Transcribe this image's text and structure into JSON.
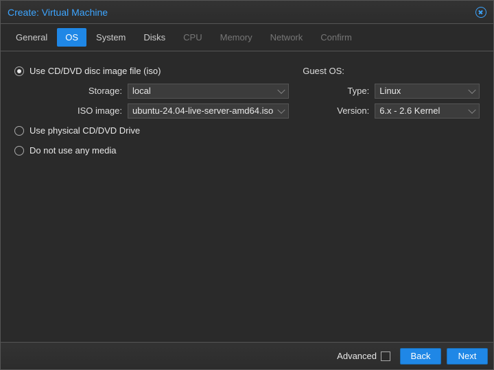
{
  "header": {
    "title": "Create: Virtual Machine"
  },
  "tabs": [
    {
      "label": "General",
      "state": "enabled"
    },
    {
      "label": "OS",
      "state": "active"
    },
    {
      "label": "System",
      "state": "enabled"
    },
    {
      "label": "Disks",
      "state": "enabled"
    },
    {
      "label": "CPU",
      "state": "disabled"
    },
    {
      "label": "Memory",
      "state": "disabled"
    },
    {
      "label": "Network",
      "state": "disabled"
    },
    {
      "label": "Confirm",
      "state": "disabled"
    }
  ],
  "media": {
    "opt_iso": "Use CD/DVD disc image file (iso)",
    "opt_physical": "Use physical CD/DVD Drive",
    "opt_none": "Do not use any media",
    "selected": "opt_iso",
    "storage_label": "Storage:",
    "storage_value": "local",
    "iso_label": "ISO image:",
    "iso_value": "ubuntu-24.04-live-server-amd64.iso"
  },
  "guest": {
    "header": "Guest OS:",
    "type_label": "Type:",
    "type_value": "Linux",
    "version_label": "Version:",
    "version_value": "6.x - 2.6 Kernel"
  },
  "footer": {
    "advanced": "Advanced",
    "back": "Back",
    "next": "Next"
  }
}
